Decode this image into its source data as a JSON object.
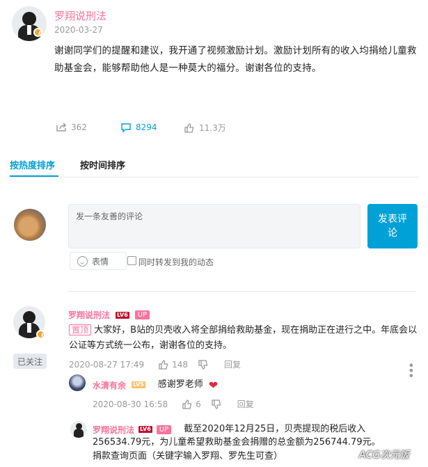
{
  "post": {
    "author": "罗翔说刑法",
    "date": "2020-03-27",
    "text": "谢谢同学们的提醒和建议，我开通了视频激励计划。激励计划所有的收入均捐给儿童救助基金会，能够帮助他人是一种莫大的福分。谢谢各位的支持。",
    "share_count": "362",
    "comment_count": "8294",
    "like_count": "11.3万"
  },
  "tabs": {
    "hot": "按热度排序",
    "time": "按时间排序"
  },
  "composer": {
    "placeholder": "发一条友善的评论",
    "submit": "发表评论",
    "emoji": "表情",
    "sync": "同时转发到我的动态"
  },
  "comments": [
    {
      "author": "罗翔说刑法",
      "level": "LV6",
      "up_tag": "UP",
      "pin": "置顶",
      "text": "大家好，B站的贝壳收入将全部捐给救助基金，现在捐助正在进行之中。年底会以公证等方式统一公布，谢谢各位的支持。",
      "date": "2020-08-27 17:49",
      "likes": "148",
      "reply": "回复",
      "follow": "已关注"
    }
  ],
  "replies": [
    {
      "author": "水清有余",
      "level": "LV5",
      "text": "感谢罗老师",
      "date": "2020-08-30 16:58",
      "likes": "6",
      "reply": "回复"
    },
    {
      "author": "罗翔说刑法",
      "level": "LV6",
      "up_tag": "UP",
      "text_line1": "截至2020年12月25日，贝壳提现的税后收入",
      "text_line2": "256534.79元，为儿童希望救助基金会捐赠的总金额为256744.79元。",
      "text_line3": "捐款查询页面（关键字输入罗翔、罗先生可查）"
    }
  ],
  "watermark": "ACG次元饭",
  "colors": {
    "accent": "#00a1d6",
    "username": "#fb7299",
    "level": "#c1102b"
  }
}
